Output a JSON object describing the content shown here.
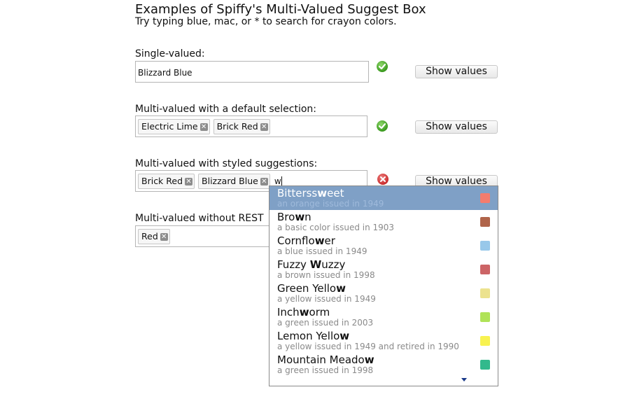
{
  "header": {
    "title": "Examples of Spiffy's Multi-Valued Suggest Box",
    "subtitle": "Try typing blue, mac, or * to search for crayon colors."
  },
  "sections": [
    {
      "label": "Single-valued:",
      "value": "Blizzard Blue",
      "status": "valid",
      "button": "Show values"
    },
    {
      "label": "Multi-valued with a default selection:",
      "tags": [
        "Electric Lime",
        "Brick Red"
      ],
      "status": "valid",
      "button": "Show values"
    },
    {
      "label": "Multi-valued with styled suggestions:",
      "tags": [
        "Brick Red",
        "Blizzard Blue"
      ],
      "typed": "w",
      "status": "invalid",
      "button": "Show values"
    },
    {
      "label": "Multi-valued without REST",
      "tags": [
        "Red"
      ]
    }
  ],
  "suggestions": [
    {
      "pre": "Bitterss",
      "match": "w",
      "post": "eet",
      "desc": "an orange issued in 1949",
      "color": "#f47c6e",
      "selected": true
    },
    {
      "pre": "Bro",
      "match": "w",
      "post": "n",
      "desc": "a basic color issued in 1903",
      "color": "#b0644a",
      "selected": false
    },
    {
      "pre": "Cornflo",
      "match": "w",
      "post": "er",
      "desc": "a blue issued in 1949",
      "color": "#98c8ea",
      "selected": false
    },
    {
      "pre": "Fuzzy ",
      "match": "W",
      "post": "uzzy",
      "desc": "a brown issued in 1998",
      "color": "#cc6466",
      "selected": false
    },
    {
      "pre": "Green Yello",
      "match": "w",
      "post": "",
      "desc": "a yellow issued in 1949",
      "color": "#ece28e",
      "selected": false
    },
    {
      "pre": "Inch",
      "match": "w",
      "post": "orm",
      "desc": "a green issued in 2003",
      "color": "#b0e358",
      "selected": false
    },
    {
      "pre": "Lemon Yello",
      "match": "w",
      "post": "",
      "desc": "a yellow issued in 1949 and retired in 1990",
      "color": "#f8f250",
      "selected": false
    },
    {
      "pre": "Mountain Meado",
      "match": "w",
      "post": "",
      "desc": "a green issued in 1998",
      "color": "#32b98c",
      "selected": false
    }
  ]
}
